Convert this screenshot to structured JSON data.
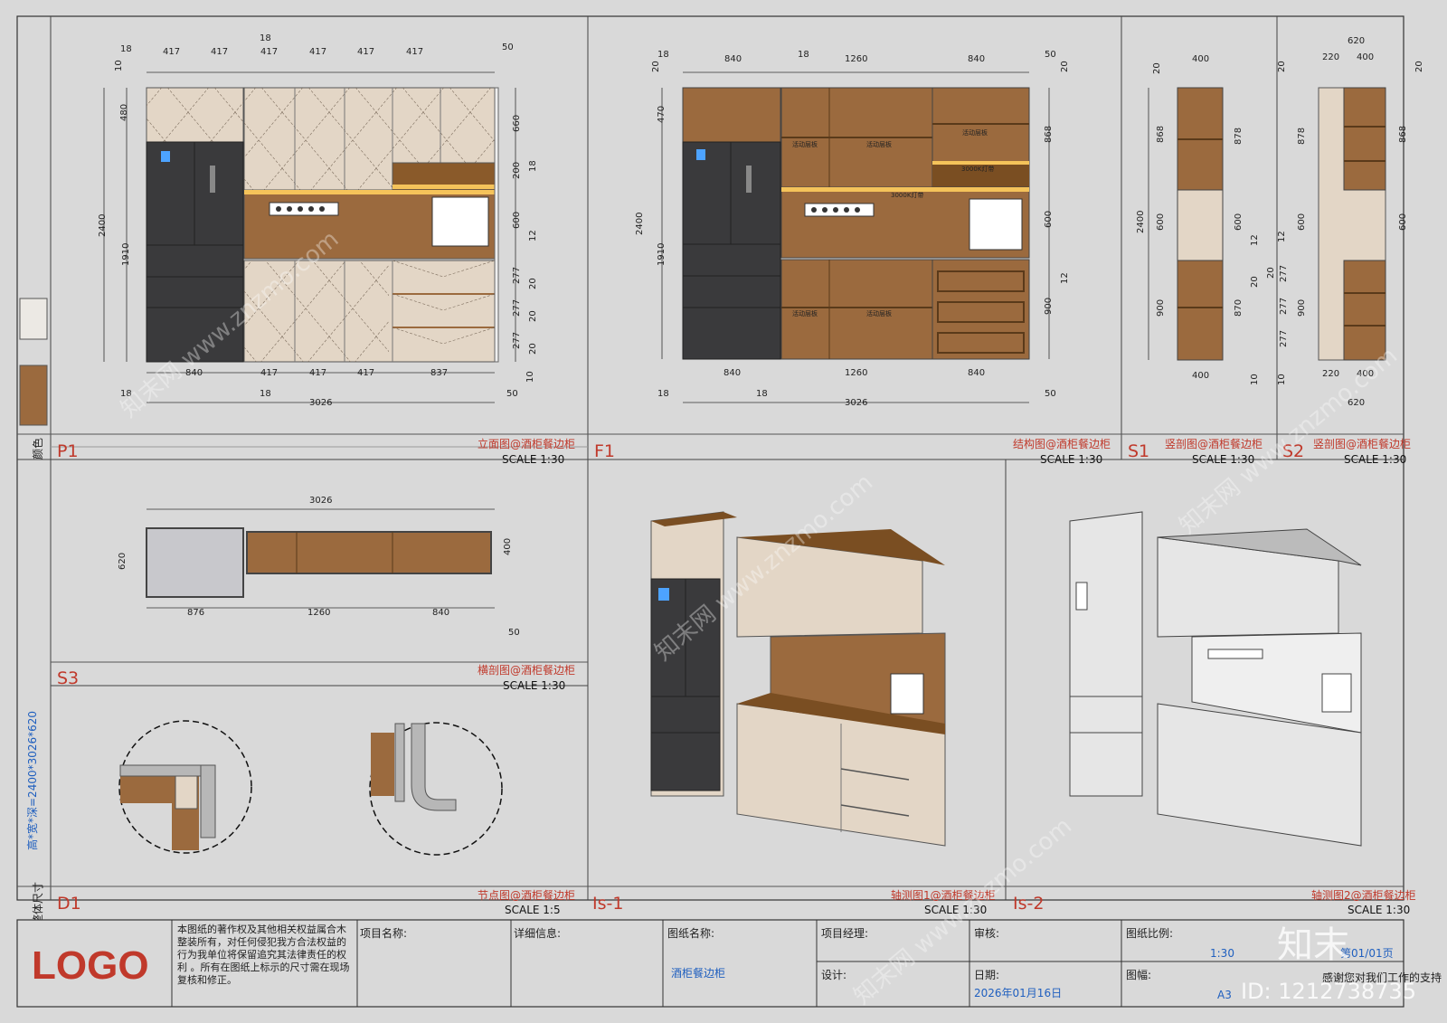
{
  "panels": {
    "p1": {
      "code": "P1",
      "title": "立面图@酒柜餐边柜",
      "scale": "SCALE 1:30"
    },
    "f1": {
      "code": "F1",
      "title": "结构图@酒柜餐边柜",
      "scale": "SCALE 1:30"
    },
    "s1": {
      "code": "S1",
      "title": "竖剖图@酒柜餐边柜",
      "scale": "SCALE 1:30"
    },
    "s2": {
      "code": "S2",
      "title": "竖剖图@酒柜餐边柜",
      "scale": "SCALE 1:30"
    },
    "s3": {
      "code": "S3",
      "title": "横剖图@酒柜餐边柜",
      "scale": "SCALE 1:30"
    },
    "d1": {
      "code": "D1",
      "title": "节点图@酒柜餐边柜",
      "scale": "SCALE 1:5"
    },
    "is1": {
      "code": "Is-1",
      "title": "轴测图1@酒柜餐边柜",
      "scale": "SCALE 1:30"
    },
    "is2": {
      "code": "Is-2",
      "title": "轴测图2@酒柜餐边柜",
      "scale": "SCALE 1:30"
    }
  },
  "side": {
    "color_label": "颜色",
    "size_label": "整体尺寸",
    "size_value": "高*宽*深=2400*3026*620"
  },
  "labels": {
    "shelf": "活动层板",
    "light": "3000K灯带"
  },
  "dims": {
    "p1_top": [
      "18",
      "417",
      "417",
      "18",
      "417",
      "417",
      "417",
      "417",
      "50"
    ],
    "p1_total": "3026",
    "p1_bottom": [
      "840",
      "417",
      "417",
      "417",
      "837"
    ],
    "p1_left": [
      "480",
      "1910",
      "2400",
      "10",
      "18",
      "18"
    ],
    "p1_right": [
      "660",
      "200",
      "600",
      "277",
      "277",
      "277",
      "18",
      "12",
      "20",
      "20",
      "20",
      "10",
      "50"
    ],
    "f1_top": [
      "18",
      "840",
      "18",
      "1260",
      "840",
      "50"
    ],
    "f1_left": [
      "470",
      "1910",
      "2400",
      "20"
    ],
    "f1_right": [
      "868",
      "600",
      "900",
      "12",
      "20"
    ],
    "f1_bottom": [
      "840",
      "1260",
      "840",
      "18",
      "18",
      "50"
    ],
    "s1": [
      "400",
      "868",
      "600",
      "900",
      "878",
      "600",
      "870",
      "2400",
      "20",
      "12",
      "20",
      "10",
      "400"
    ],
    "s2": [
      "620",
      "220",
      "400",
      "878",
      "600",
      "900",
      "868",
      "600",
      "20",
      "277",
      "277",
      "277",
      "12",
      "10",
      "20",
      "20",
      "220",
      "400",
      "620"
    ],
    "s3": [
      "3026",
      "620",
      "876",
      "1260",
      "840",
      "400",
      "50"
    ]
  },
  "titleblock": {
    "logo": "LOGO",
    "copyright": "本图纸的著作权及其他相关权益属合木整装所有，对任何侵犯我方合法权益的行为我单位将保留追究其法律责任的权利 。所有在图纸上标示的尺寸需在现场复核和修正。",
    "project_label": "项目名称:",
    "detail_label": "详细信息:",
    "drawing_label": "图纸名称:",
    "drawing_value": "酒柜餐边柜",
    "manager_label": "项目经理:",
    "review_label": "审核:",
    "design_label": "设计:",
    "date_label": "日期:",
    "date_value": "2026年01月16日",
    "ratio_label": "图纸比例:",
    "ratio_value": "1:30",
    "size_label": "图幅:",
    "size_value": "A3",
    "page_value": "第01/01页",
    "thanks": "感谢您对我们工作的支持"
  },
  "watermark": {
    "text": "知末网 www.znzmo.com",
    "brand": "知末",
    "id": "ID: 1212738735"
  },
  "colors": {
    "wood": "#9b6a3e",
    "cream": "#e3d6c6",
    "dark": "#3a3a3c",
    "accent": "#c0392b",
    "blue": "#1f5fbf"
  }
}
